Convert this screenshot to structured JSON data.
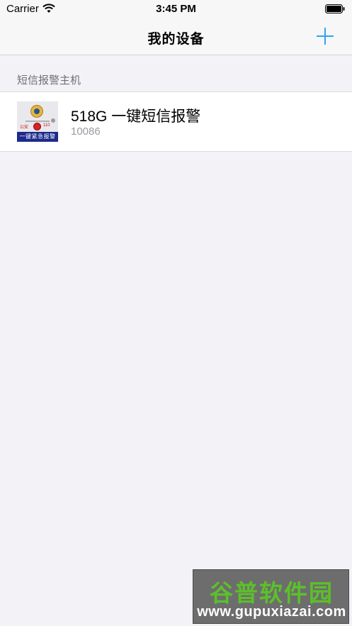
{
  "status_bar": {
    "carrier": "Carrier",
    "time": "3:45 PM"
  },
  "nav": {
    "title": "我的设备",
    "add_icon": "plus-icon",
    "accent_color": "#2fa3f3"
  },
  "section": {
    "header": "短信报警主机"
  },
  "devices": [
    {
      "name": "518G 一键短信报警",
      "number": "10086",
      "thumbnail": {
        "label_left": "公安",
        "label_number": "110",
        "banner": "一键紧急报警"
      }
    }
  ],
  "watermark": {
    "title": "谷普软件园",
    "url": "www.gupuxiazai.com",
    "title_color": "#5cc02a"
  }
}
